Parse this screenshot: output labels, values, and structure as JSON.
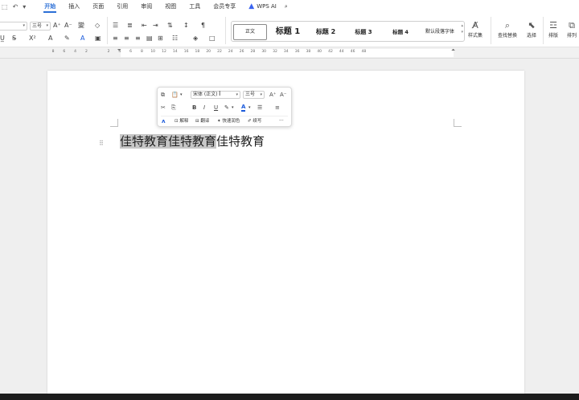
{
  "menu": {
    "quick_access": [
      "⬚",
      "↶",
      "▾"
    ],
    "tabs": [
      {
        "label": "开始",
        "active": true
      },
      {
        "label": "插入"
      },
      {
        "label": "页面"
      },
      {
        "label": "引用"
      },
      {
        "label": "审阅"
      },
      {
        "label": "视图"
      },
      {
        "label": "工具"
      },
      {
        "label": "会员专享"
      }
    ],
    "wps_ai": "WPS AI"
  },
  "ribbon": {
    "font_size": "三号",
    "styles": [
      "正文",
      "标题 1",
      "标题 2",
      "标题 3",
      "标题 4",
      "默认段落字体"
    ],
    "style_set": "样式集",
    "find_replace": "查找替换",
    "select": "选择",
    "typeset": "排版",
    "arrange": "排列"
  },
  "ruler": {
    "numbers": [
      "8",
      "6",
      "4",
      "2",
      "",
      "2",
      "4",
      "6",
      "8",
      "10",
      "12",
      "14",
      "16",
      "18",
      "20",
      "22",
      "24",
      "26",
      "28",
      "30",
      "32",
      "34",
      "36",
      "38",
      "40",
      "42",
      "44",
      "46",
      "48"
    ]
  },
  "document": {
    "selected_text": "佳特教育佳特教育",
    "rest_text": "佳特教育"
  },
  "minibar": {
    "font_name": "宋体 (正文)",
    "font_size": "三号",
    "bold": "B",
    "italic": "I",
    "underline": "U",
    "actions": {
      "explain": "解释",
      "translate": "翻译",
      "polish": "快速润色",
      "continue_write": "续写"
    },
    "more": "···"
  },
  "colors": {
    "accent": "#2b6fd6",
    "selection": "#c7c7c7",
    "canvas": "#efefef"
  }
}
